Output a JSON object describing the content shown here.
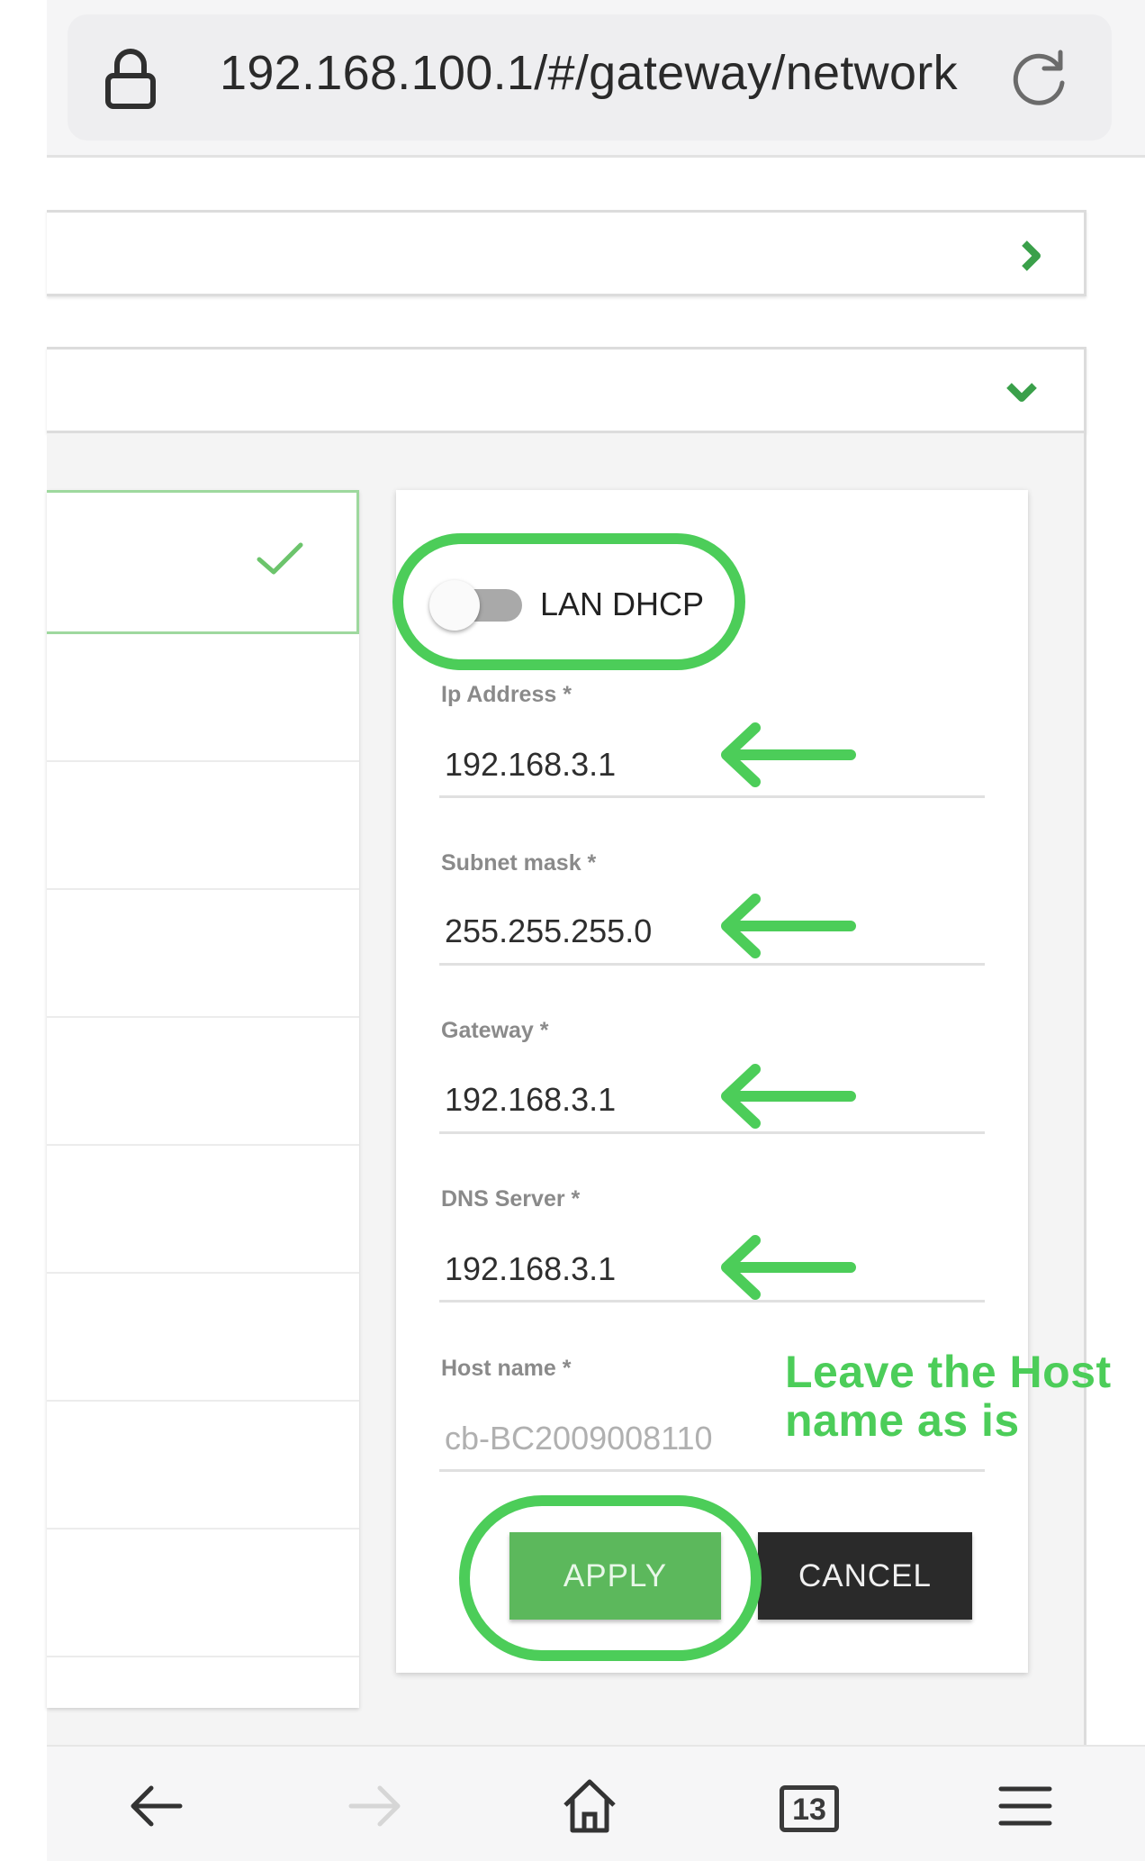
{
  "browser": {
    "url": "192.168.100.1/#/gateway/network",
    "tab_count": "13"
  },
  "form": {
    "toggle_label": "LAN DHCP",
    "toggle_on": false,
    "fields": [
      {
        "label": "Ip Address *",
        "value": "192.168.3.1"
      },
      {
        "label": "Subnet mask *",
        "value": "255.255.255.0"
      },
      {
        "label": "Gateway *",
        "value": "192.168.3.1"
      },
      {
        "label": "DNS Server *",
        "value": "192.168.3.1"
      },
      {
        "label": "Host name *",
        "value": "cb-BC2009008110"
      }
    ],
    "apply_label": "APPLY",
    "cancel_label": "CANCEL"
  },
  "annotation": {
    "note": "Leave the Host name as is",
    "accent_color": "#4ccd59"
  },
  "icons": {
    "lock": "lock-icon",
    "reload": "reload-icon",
    "chevron_right": "chevron-right-icon",
    "chevron_down": "chevron-down-icon",
    "check": "check-icon",
    "back": "back-arrow-icon",
    "forward": "forward-arrow-icon",
    "home": "home-icon",
    "menu": "menu-icon"
  },
  "colors": {
    "brand_green": "#5cb85c",
    "cancel_dark": "#2a2a2a"
  }
}
